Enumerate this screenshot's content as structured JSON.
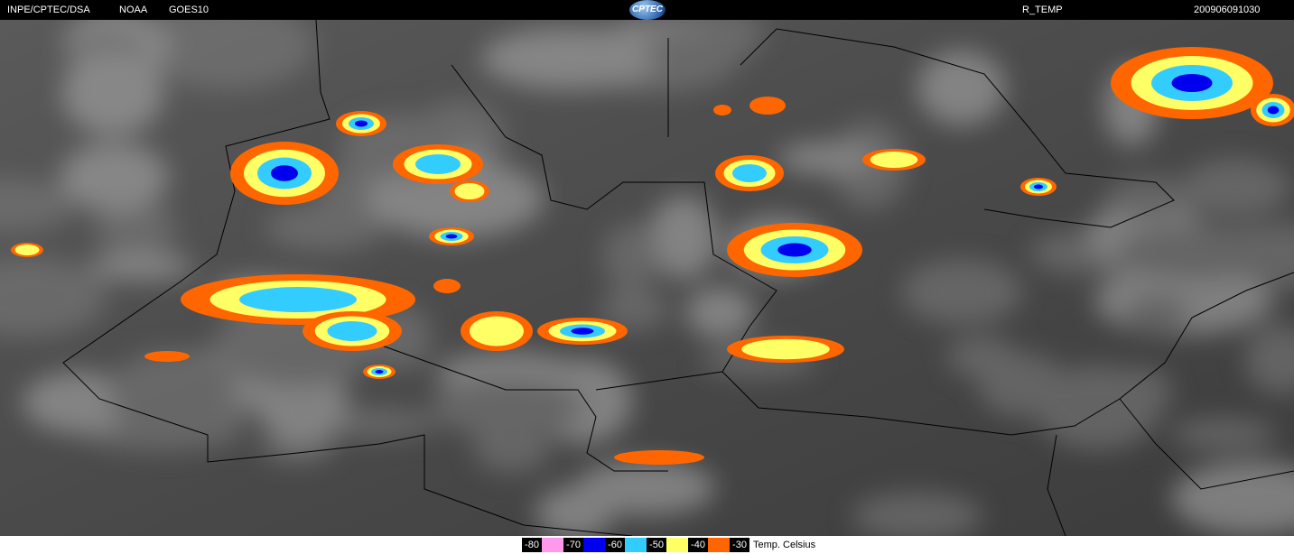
{
  "header": {
    "source": "INPE/CPTEC/DSA",
    "agency": "NOAA",
    "satellite": "GOES10",
    "logo_text": "CPTEC",
    "product": "R_TEMP",
    "timestamp": "200906091030"
  },
  "legend": {
    "unit_label": "Temp. Celsius",
    "entries": [
      {
        "label": "-80",
        "color": "#ff99ee"
      },
      {
        "label": "-70",
        "color": "#0000ee"
      },
      {
        "label": "-60",
        "color": "#33ccff"
      },
      {
        "label": "-50",
        "color": "#ffff66"
      },
      {
        "label": "-40",
        "color": "#ff6600"
      }
    ],
    "last_label": "-30"
  }
}
